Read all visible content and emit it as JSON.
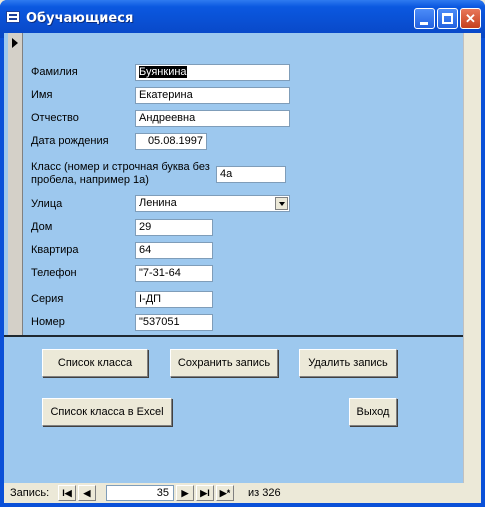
{
  "window": {
    "title": "Обучающиеся"
  },
  "form": {
    "surname": {
      "label": "Фамилия",
      "value": "Буянкина"
    },
    "name": {
      "label": "Имя",
      "value": "Екатерина"
    },
    "patronymic": {
      "label": "Отчество",
      "value": "Андреевна"
    },
    "birthdate": {
      "label": "Дата рождения",
      "value": "05.08.1997"
    },
    "class": {
      "label": "Класс (номер и строчная буква без пробела, например 1а)",
      "value": "4а"
    },
    "street": {
      "label": "Улица",
      "value": "Ленина"
    },
    "house": {
      "label": "Дом",
      "value": "29"
    },
    "apartment": {
      "label": "Квартира",
      "value": "64"
    },
    "phone": {
      "label": "Телефон",
      "value": "\"7-31-64"
    },
    "series": {
      "label": "Серия",
      "value": "I-ДП"
    },
    "number": {
      "label": "Номер",
      "value": "\"537051"
    }
  },
  "buttons": {
    "class_list": "Список класса",
    "save": "Сохранить запись",
    "delete": "Удалить запись",
    "class_list_excel": "Список класса в Excel",
    "exit": "Выход"
  },
  "navigation": {
    "label": "Запись:",
    "current": "35",
    "of_label": "из",
    "total": "326",
    "first": "I◀",
    "prev": "◀",
    "next": "▶",
    "last": "▶I",
    "new": "▶*"
  },
  "titlebar_buttons": {
    "close": "✕"
  }
}
